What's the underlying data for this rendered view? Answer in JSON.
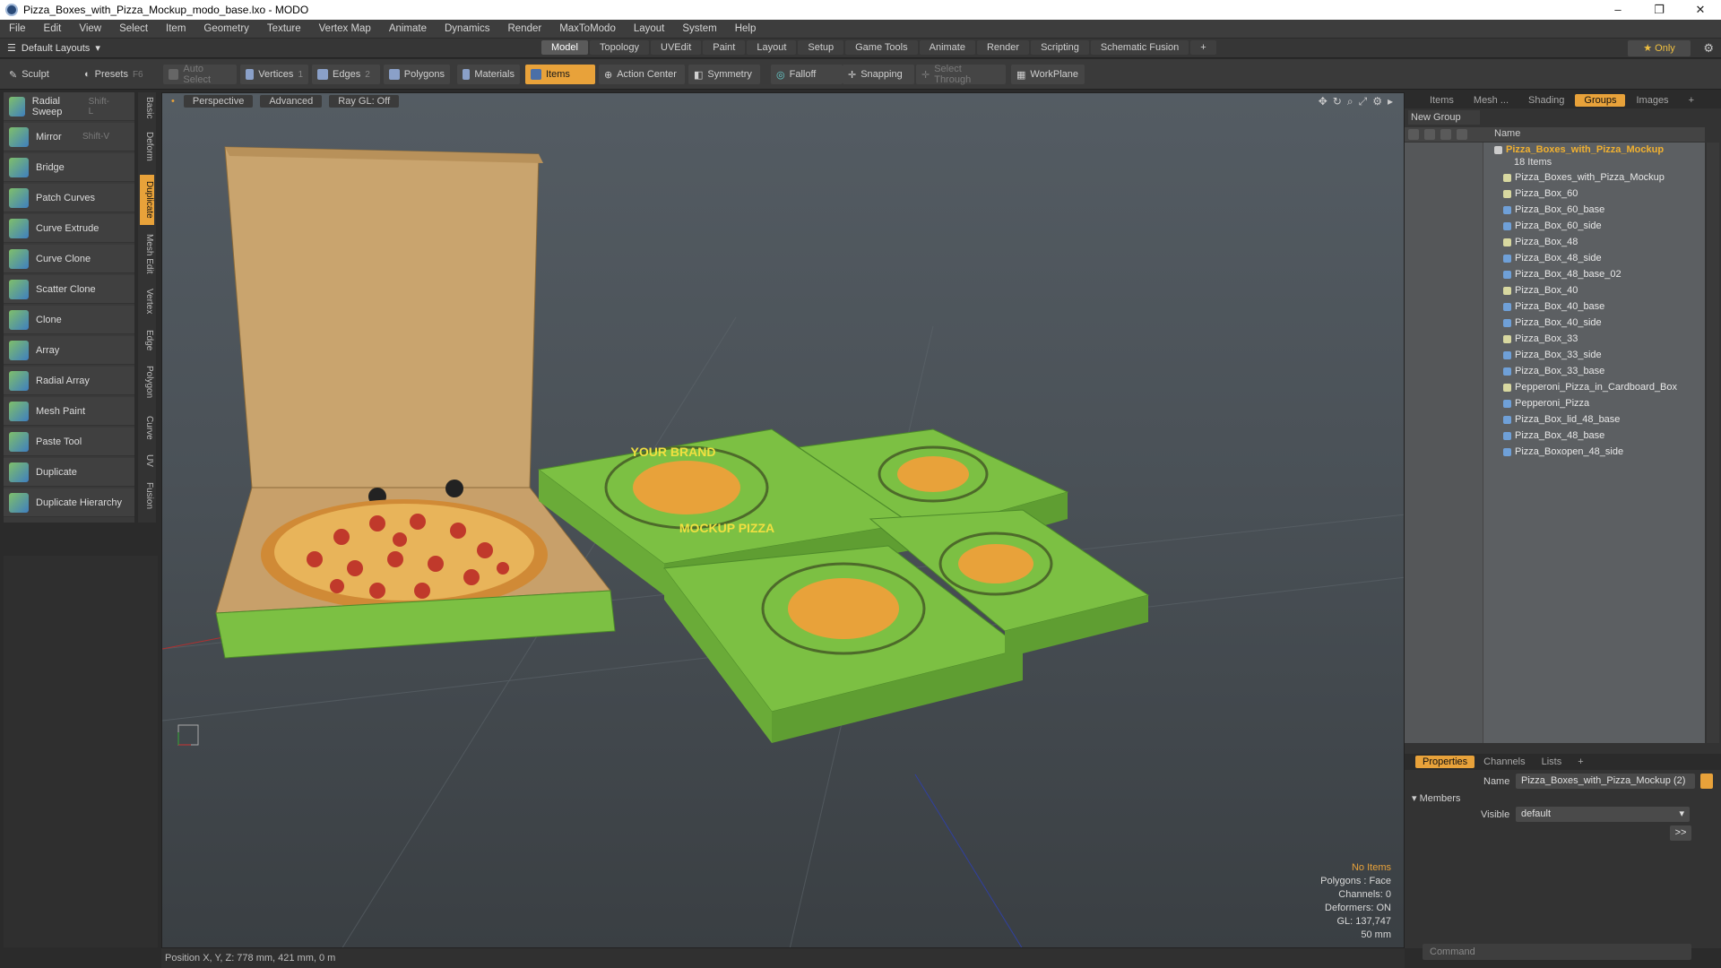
{
  "window": {
    "title": "Pizza_Boxes_with_Pizza_Mockup_modo_base.lxo - MODO",
    "controls": [
      "–",
      "❐",
      "✕"
    ]
  },
  "menu": [
    "File",
    "Edit",
    "View",
    "Select",
    "Item",
    "Geometry",
    "Texture",
    "Vertex Map",
    "Animate",
    "Dynamics",
    "Render",
    "MaxToModo",
    "Layout",
    "System",
    "Help"
  ],
  "layoutbar": {
    "layouts_label": "Default Layouts",
    "tabs": [
      "Model",
      "Topology",
      "UVEdit",
      "Paint",
      "Layout",
      "Setup",
      "Game Tools",
      "Animate",
      "Render",
      "Scripting",
      "Schematic Fusion",
      "+"
    ],
    "active_tab": "Model",
    "only_label": "Only"
  },
  "toolbar": {
    "sculpt": "Sculpt",
    "presets": "Presets",
    "presets_key": "F6",
    "auto_select": "Auto Select",
    "vertices": "Vertices",
    "vertices_count": "1",
    "edges": "Edges",
    "edges_count": "2",
    "polygons": "Polygons",
    "materials": "Materials",
    "items": "Items",
    "action_center": "Action Center",
    "symmetry": "Symmetry",
    "falloff": "Falloff",
    "snapping": "Snapping",
    "select_through": "Select Through",
    "workplane": "WorkPlane"
  },
  "tools": [
    {
      "label": "Radial Sweep",
      "shortcut": "Shift-L"
    },
    {
      "label": "Mirror",
      "shortcut": "Shift-V"
    },
    {
      "label": "Bridge",
      "shortcut": ""
    },
    {
      "label": "Patch Curves",
      "shortcut": ""
    },
    {
      "label": "Curve Extrude",
      "shortcut": ""
    },
    {
      "label": "Curve Clone",
      "shortcut": ""
    },
    {
      "label": "Scatter Clone",
      "shortcut": ""
    },
    {
      "label": "Clone",
      "shortcut": ""
    },
    {
      "label": "Array",
      "shortcut": ""
    },
    {
      "label": "Radial Array",
      "shortcut": ""
    },
    {
      "label": "Mesh Paint",
      "shortcut": ""
    },
    {
      "label": "Paste Tool",
      "shortcut": ""
    },
    {
      "label": "Duplicate",
      "shortcut": ""
    },
    {
      "label": "Duplicate Hierarchy",
      "shortcut": ""
    }
  ],
  "vtabs": [
    "Basic",
    "Deform",
    "Duplicate",
    "Mesh Edit",
    "Vertex",
    "Edge",
    "Polygon",
    "Curve",
    "UV",
    "Fusion"
  ],
  "active_vtab": "Duplicate",
  "viewport": {
    "view": "Perspective",
    "shading": "Advanced",
    "raygl": "Ray GL: Off",
    "info": {
      "no_items": "No Items",
      "polygons": "Polygons : Face",
      "channels": "Channels: 0",
      "deformers": "Deformers: ON",
      "gl": "GL: 137,747",
      "focal": "50 mm"
    },
    "box_text_top": "YOUR BRAND",
    "box_text_bottom": "MOCKUP PIZZA"
  },
  "status": {
    "position": "Position X, Y, Z:  778 mm, 421 mm, 0 m"
  },
  "right_tabs": [
    "Items",
    "Mesh ...",
    "Shading",
    "Groups",
    "Images",
    "+"
  ],
  "active_right_tab": "Groups",
  "groups": {
    "new_group": "New Group",
    "name_header": "Name",
    "root": "Pizza_Boxes_with_Pizza_Mockup",
    "root_count": "18 Items",
    "items": [
      {
        "name": "Pizza_Boxes_with_Pizza_Mockup",
        "kind": "locator"
      },
      {
        "name": "Pizza_Box_60",
        "kind": "locator"
      },
      {
        "name": "Pizza_Box_60_base",
        "kind": "mesh"
      },
      {
        "name": "Pizza_Box_60_side",
        "kind": "mesh"
      },
      {
        "name": "Pizza_Box_48",
        "kind": "locator"
      },
      {
        "name": "Pizza_Box_48_side",
        "kind": "mesh"
      },
      {
        "name": "Pizza_Box_48_base_02",
        "kind": "mesh"
      },
      {
        "name": "Pizza_Box_40",
        "kind": "locator"
      },
      {
        "name": "Pizza_Box_40_base",
        "kind": "mesh"
      },
      {
        "name": "Pizza_Box_40_side",
        "kind": "mesh"
      },
      {
        "name": "Pizza_Box_33",
        "kind": "locator"
      },
      {
        "name": "Pizza_Box_33_side",
        "kind": "mesh"
      },
      {
        "name": "Pizza_Box_33_base",
        "kind": "mesh"
      },
      {
        "name": "Pepperoni_Pizza_in_Cardboard_Box",
        "kind": "locator"
      },
      {
        "name": "Pepperoni_Pizza",
        "kind": "mesh"
      },
      {
        "name": "Pizza_Box_lid_48_base",
        "kind": "mesh"
      },
      {
        "name": "Pizza_Box_48_base",
        "kind": "mesh"
      },
      {
        "name": "Pizza_Boxopen_48_side",
        "kind": "mesh"
      }
    ]
  },
  "properties_tabs": [
    "Properties",
    "Channels",
    "Lists",
    "+"
  ],
  "active_properties_tab": "Properties",
  "properties": {
    "name_label": "Name",
    "name_value": "Pizza_Boxes_with_Pizza_Mockup (2)",
    "members_label": "Members",
    "visible_label": "Visible",
    "visible_value": "default",
    "arrow_button": ">>"
  },
  "command_placeholder": "Command",
  "colors": {
    "accent": "#e8a23a",
    "box_green": "#7cc043",
    "panel": "#3a3a3a"
  }
}
